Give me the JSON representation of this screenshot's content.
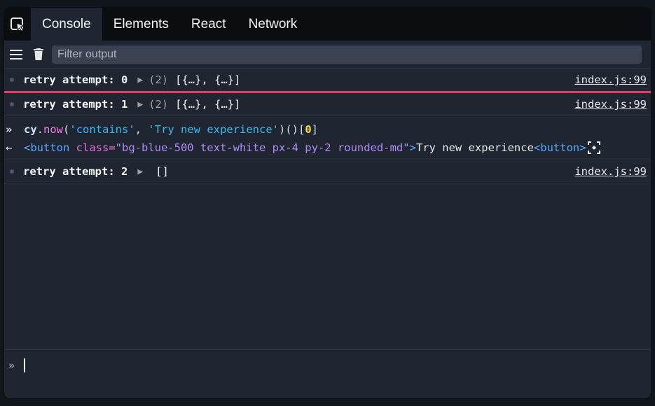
{
  "tabs": [
    {
      "label": "Console",
      "active": true
    },
    {
      "label": "Elements"
    },
    {
      "label": "React"
    },
    {
      "label": "Network"
    }
  ],
  "toolbar": {
    "filter_placeholder": "Filter output"
  },
  "logs": [
    {
      "text": "retry attempt: 0",
      "count": "(2)",
      "array": "[{…}, {…}]",
      "source": "index.js:99"
    },
    {
      "text": "retry attempt: 1",
      "count": "(2)",
      "array": "[{…}, {…}]",
      "source": "index.js:99"
    },
    {
      "text": "retry attempt: 2",
      "count": "",
      "array": "[]",
      "source": "index.js:99"
    }
  ],
  "command": {
    "prompt": "»",
    "obj": "cy",
    "dot": ".",
    "fn": "now",
    "open": "(",
    "arg1": "'contains'",
    "comma": ", ",
    "arg2": "'Try new experience'",
    "close_call": ")()[",
    "index": "0",
    "close_idx": "]"
  },
  "result": {
    "arrow": "←",
    "tag_open": "<button",
    "attr_name": " class=",
    "attr_value": "\"bg-blue-500 text-white px-4 py-2 rounded-md\"",
    "tag_close": ">",
    "text": "Try new experience",
    "end_tag": "<button>"
  },
  "input": {
    "prompt": "»"
  },
  "colors": {
    "error_separator": "#e0405e",
    "background": "#1f2632",
    "tabbar": "#0b0d11"
  }
}
